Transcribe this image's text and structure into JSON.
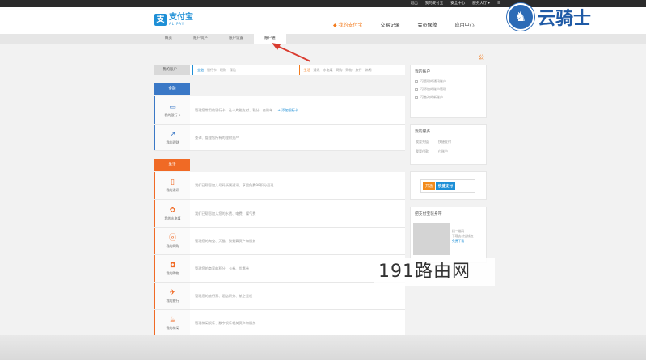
{
  "topbar": {
    "links": [
      "退出",
      "我的支付宝",
      "安全中心",
      "服务大厅 ▾"
    ],
    "menu_icon": "☰"
  },
  "logo": {
    "cn": "支付宝",
    "en": "ALIPAY",
    "mark": "支"
  },
  "mainnav": {
    "items": [
      {
        "label": "◆ 我的支付宝",
        "active": true
      },
      {
        "label": "交易记录"
      },
      {
        "label": "会员保障"
      },
      {
        "label": "应用中心"
      }
    ]
  },
  "subnav": {
    "tabs": [
      {
        "label": "概览"
      },
      {
        "label": "账户资产"
      },
      {
        "label": "账户设置"
      },
      {
        "label": "账户通",
        "active": true
      }
    ]
  },
  "account_row": {
    "label": "我的账户",
    "finance": {
      "key": "金融",
      "items": [
        "银行卡",
        "理财",
        "保险"
      ]
    },
    "life": {
      "key": "生活",
      "items": [
        "通讯",
        "水电煤",
        "网购",
        "购物",
        "旅行",
        "休闲"
      ]
    }
  },
  "sections": {
    "finance_tag": "金融",
    "life_tag": "生活"
  },
  "finance_rows": [
    {
      "name": "我的银行卡",
      "icon": "card-icon",
      "glyph": "▭",
      "desc": "管理您常用的银行卡，让卡片能支付、积分、查账单",
      "link": "+ 添加银行卡"
    },
    {
      "name": "我的理财",
      "icon": "chart-icon",
      "glyph": "↗",
      "desc": "查询、管理您所有的理财资产",
      "link": ""
    }
  ],
  "life_rows": [
    {
      "name": "我的通讯",
      "icon": "phone-icon",
      "glyph": "▯",
      "desc": "我们已帮您加入号码所属通讯，享受免费98积分返现"
    },
    {
      "name": "我的水电煤",
      "icon": "utility-icon",
      "glyph": "✿",
      "desc": "我们已帮您加入您的水费、电费、煤气费"
    },
    {
      "name": "我的网购",
      "icon": "shopping-icon",
      "glyph": "ⓐ",
      "desc": "管理您的淘宝、天猫、聚划算资产和服务"
    },
    {
      "name": "我的购物",
      "icon": "bag-icon",
      "glyph": "◘",
      "desc": "管理您的商家的积分、卡券、优惠券"
    },
    {
      "name": "我的旅行",
      "icon": "plane-icon",
      "glyph": "✈",
      "desc": "管理您的旅行票、酒店积分、航空里程"
    },
    {
      "name": "我的休闲",
      "icon": "coffee-icon",
      "glyph": "☕",
      "desc": "管理休闲娱乐、数字娱乐相关资产和服务"
    }
  ],
  "side": {
    "accounts_title": "我的账户",
    "accounts_items": [
      "可管理的通讯账户",
      "可添加的账户管理",
      "可查询的新账户"
    ],
    "services_title": "我的服务",
    "services_pairs": [
      [
        "我要充值",
        "快捷支付"
      ],
      [
        "我要付款",
        "付账户"
      ]
    ],
    "quickpay_open": "开通",
    "quickpay_name": "快捷支付",
    "qr_title": "把支付宝装身带",
    "qr_lines": [
      "扫二维码",
      "下载支付宝钱包"
    ],
    "qr_link": "免费下载"
  },
  "ad_icon": "公",
  "watermarks": {
    "top": "云骑士",
    "top_mark": "♞",
    "bottom": "191路由网"
  },
  "colors": {
    "brand": "#1e8fd6",
    "orange": "#f37b1d",
    "finance": "#3a78c6",
    "life": "#f06a25"
  }
}
